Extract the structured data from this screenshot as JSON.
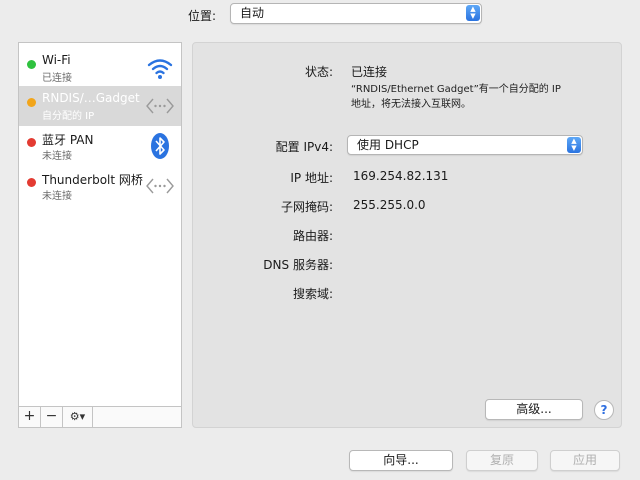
{
  "location": {
    "label": "位置:",
    "value": "自动"
  },
  "services": [
    {
      "name": "Wi-Fi",
      "status": "已连接",
      "dot_color": "#2fc23f",
      "icon": "wifi-icon"
    },
    {
      "name": "RNDIS/…Gadget",
      "status": "自分配的 IP",
      "dot_color": "#f2a51a",
      "icon": "ethernet-icon"
    },
    {
      "name": "蓝牙 PAN",
      "status": "未连接",
      "dot_color": "#e33b32",
      "icon": "bluetooth-icon"
    },
    {
      "name": "Thunderbolt 网桥",
      "status": "未连接",
      "dot_color": "#e33b32",
      "icon": "ethernet-icon"
    }
  ],
  "toolbar": {
    "add": "+",
    "remove": "−",
    "gear": "⚙▾"
  },
  "detail": {
    "status_label": "状态:",
    "status_value": "已连接",
    "status_note_line1": "“RNDIS/Ethernet Gadget”有一个自分配的 IP",
    "status_note_line2": "地址，将无法接入互联网。",
    "ipv4_label": "配置 IPv4:",
    "ipv4_value": "使用 DHCP",
    "ip_label": "IP 地址:",
    "ip_value": "169.254.82.131",
    "subnet_label": "子网掩码:",
    "subnet_value": "255.255.0.0",
    "router_label": "路由器:",
    "dns_label": "DNS 服务器:",
    "search_label": "搜索域:",
    "advanced_button": "高级...",
    "help_button": "?"
  },
  "footer": {
    "assistant": "向导...",
    "revert": "复原",
    "apply": "应用"
  },
  "colors": {
    "accent": "#2a73e0",
    "selected_row": "#d9d9d9",
    "panel_bg": "#e3e3e3"
  }
}
